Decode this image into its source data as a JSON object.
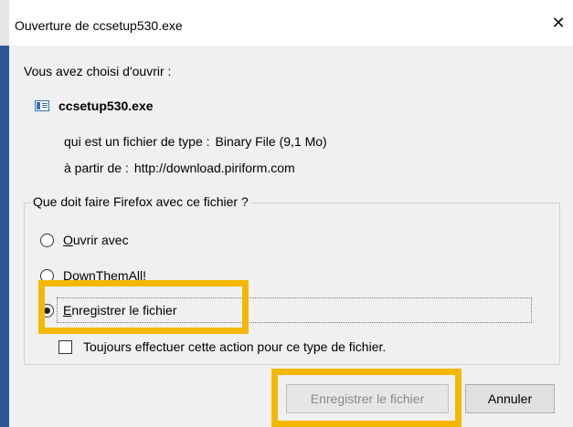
{
  "window": {
    "title": "Ouverture de ccsetup530.exe",
    "close_glyph": "✕"
  },
  "dialog": {
    "intro": "Vous avez choisi d'ouvrir :",
    "file_icon": "file-icon",
    "file_name": "ccsetup530.exe",
    "type_label": "qui est un fichier de type :",
    "type_value": "Binary File (9,1 Mo)",
    "source_label": "à partir de :",
    "source_value": "http://download.piriform.com"
  },
  "action_group": {
    "legend": "Que doit faire Firefox avec ce fichier ?",
    "options": [
      {
        "label": "Ouvrir avec",
        "checked": false
      },
      {
        "label": "DownThemAll!",
        "checked": false
      },
      {
        "label": "Enregistrer le fichier",
        "checked": true
      }
    ],
    "always_checkbox_label": "Toujours effectuer cette action pour ce type de fichier.",
    "always_checked": false
  },
  "buttons": {
    "save_label": "Enregistrer le fichier",
    "cancel_label": "Annuler"
  },
  "colors": {
    "highlight": "#f5b800",
    "window_accent": "#2b5797"
  }
}
